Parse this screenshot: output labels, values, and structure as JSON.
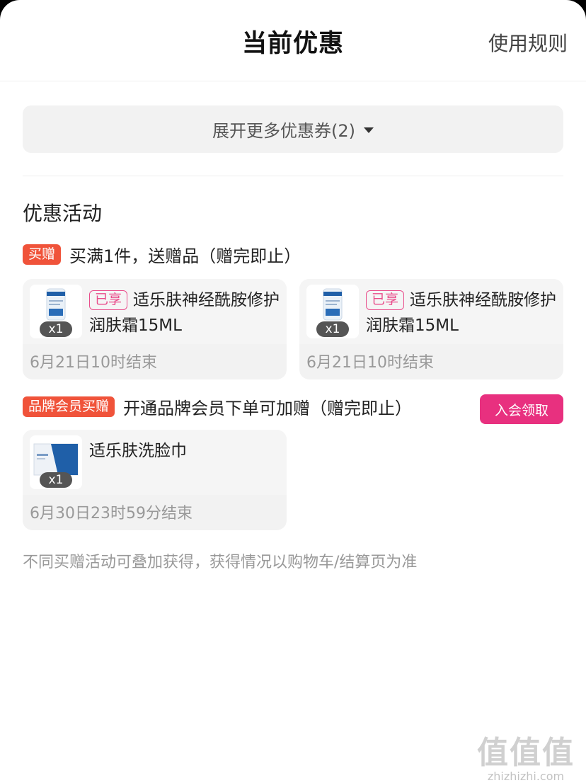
{
  "header": {
    "title": "当前优惠",
    "rules_link": "使用规则"
  },
  "expand_coupons": {
    "label": "展开更多优惠券(2)"
  },
  "section": {
    "title": "优惠活动"
  },
  "promotions": [
    {
      "badge": "买赠",
      "rule": "买满1件，送赠品（赠完即止）",
      "items": [
        {
          "tag": "已享",
          "name": "适乐肤神经酰胺修护润肤霜15ML",
          "qty": "x1",
          "end_time": "6月21日10时结束"
        },
        {
          "tag": "已享",
          "name": "适乐肤神经酰胺修护润肤霜15ML",
          "qty": "x1",
          "end_time": "6月21日10时结束"
        }
      ]
    },
    {
      "badge": "品牌会员买赠",
      "rule": "开通品牌会员下单可加赠（赠完即止）",
      "action": "入会领取",
      "items": [
        {
          "name": "适乐肤洗脸巾",
          "qty": "x1",
          "end_time": "6月30日23时59分结束"
        }
      ]
    }
  ],
  "footnote": "不同买赠活动可叠加获得，获得情况以购物车/结算页为准",
  "watermark": {
    "mark": "值值值",
    "url": "zhizhizhi.com"
  },
  "colors": {
    "badge": "#f0533a",
    "accent_pink": "#e8307f",
    "tag_pink": "#e94d8b"
  },
  "icons": [
    "caret-down-icon",
    "cerave-cream-thumbnail",
    "cerave-towel-thumbnail"
  ]
}
